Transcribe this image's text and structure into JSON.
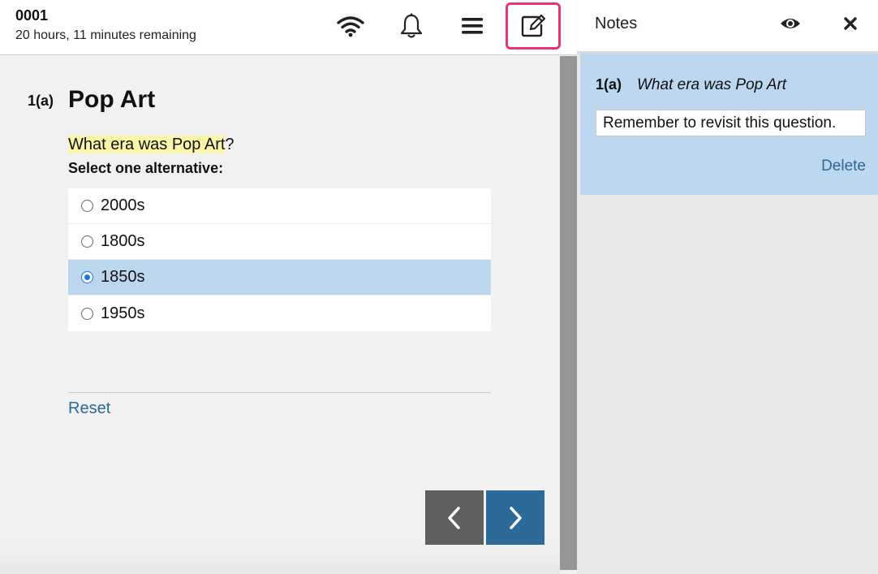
{
  "header": {
    "candidate_id": "0001",
    "time_remaining": "20 hours, 11 minutes remaining",
    "icons": [
      "wifi-icon",
      "bell-icon",
      "menu-icon",
      "edit-notes-icon"
    ],
    "highlight_color": "#e8336c"
  },
  "question": {
    "number": "1(a)",
    "title": "Pop Art",
    "text_highlighted": "What era was Pop Art",
    "text_rest": "?",
    "instruction": "Select one alternative:",
    "options": [
      {
        "label": "2000s",
        "selected": false
      },
      {
        "label": "1800s",
        "selected": false
      },
      {
        "label": "1850s",
        "selected": true
      },
      {
        "label": "1950s",
        "selected": false
      }
    ],
    "reset_label": "Reset"
  },
  "navigation": {
    "prev_icon": "chevron-left-icon",
    "next_icon": "chevron-right-icon"
  },
  "notes": {
    "title": "Notes",
    "note": {
      "ref": "1(a)",
      "question": "What era was Pop Art",
      "value": "Remember to revisit this question."
    },
    "delete_label": "Delete"
  },
  "colors": {
    "accent": "#2c6a9a",
    "selected_bg": "#bcd6ee",
    "highlight_text": "#fbf5a8"
  }
}
